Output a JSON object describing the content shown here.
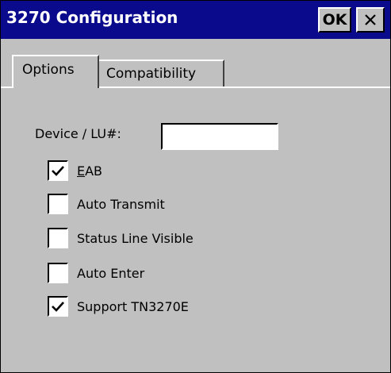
{
  "window": {
    "title": "3270 Configuration",
    "ok_label": "OK",
    "close_icon": "close-icon"
  },
  "tabs": [
    {
      "label": "Options",
      "active": true
    },
    {
      "label": "Compatibility",
      "active": false
    }
  ],
  "options": {
    "device_label": "Device / LU#:",
    "device_value": "",
    "checkboxes": [
      {
        "label_accel": "E",
        "label_rest": "AB",
        "checked": true
      },
      {
        "label": "Auto Transmit",
        "checked": false
      },
      {
        "label": "Status Line Visible",
        "checked": false
      },
      {
        "label": "Auto Enter",
        "checked": false
      },
      {
        "label": "Support TN3270E",
        "checked": true
      }
    ]
  },
  "colors": {
    "titlebar": "#0a0a8c",
    "face": "#c0c0c0",
    "title_text": "#ffffff"
  }
}
